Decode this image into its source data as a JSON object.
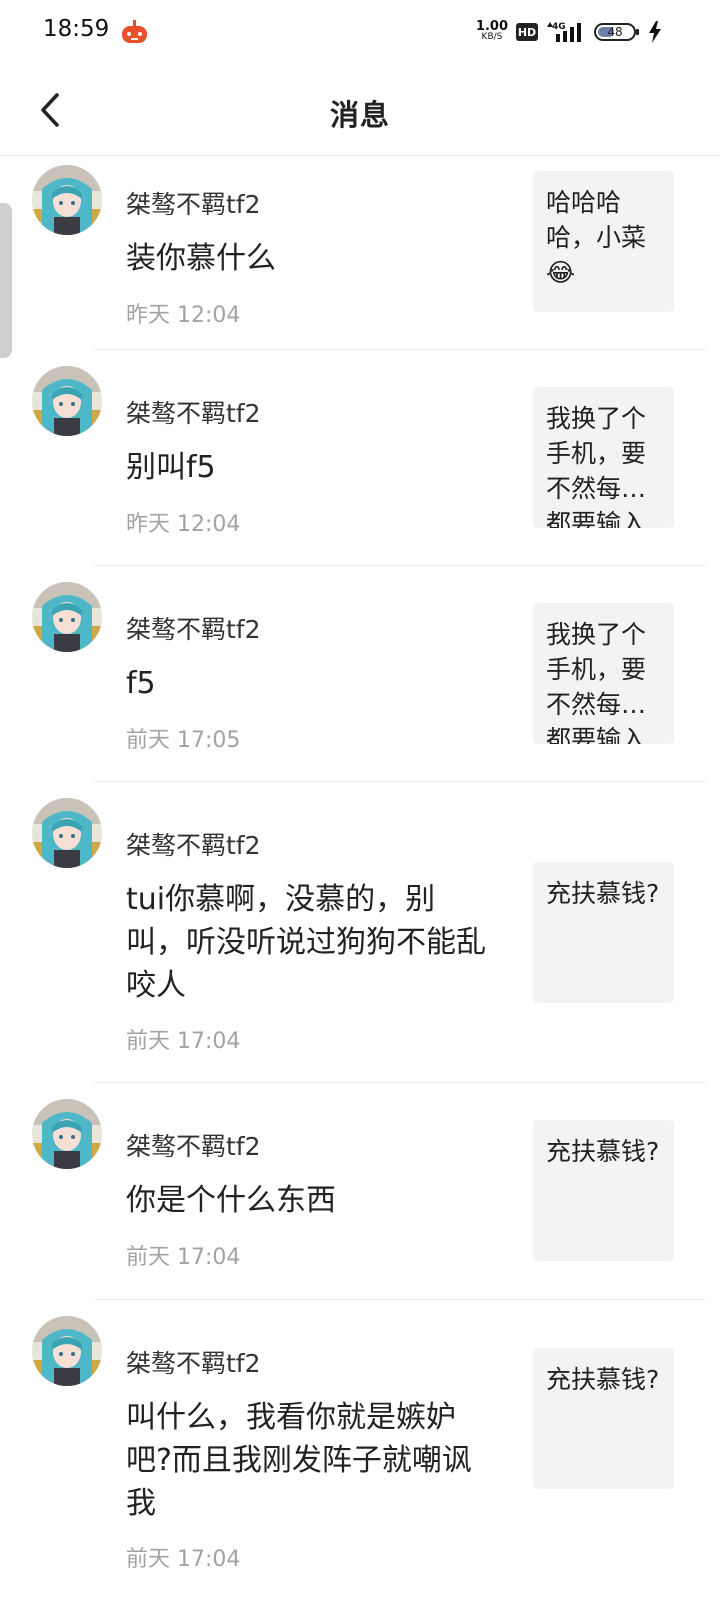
{
  "status_bar": {
    "time": "18:59",
    "net_speed_value": "1.00",
    "net_speed_unit": "KB/S",
    "hd_label": "HD",
    "network_label": "4G",
    "battery_level": "48"
  },
  "header": {
    "title": "消息",
    "back_icon": "chevron-left-icon"
  },
  "messages": [
    {
      "username": "桀骜不羁tf2",
      "comment": "装你慕什么",
      "time": "昨天 12:04",
      "quote": "哈哈哈哈，小菜😂"
    },
    {
      "username": "桀骜不羁tf2",
      "comment": "别叫f5",
      "time": "昨天 12:04",
      "quote": " 我换了个手机，要不然每次都要输入验证码"
    },
    {
      "username": "桀骜不羁tf2",
      "comment": "f5",
      "time": "前天 17:05",
      "quote": " 我换了个手机，要不然每次都要输入验证码"
    },
    {
      "username": "桀骜不羁tf2",
      "comment": "tui你慕啊，没慕的，别叫，听没听说过狗狗不能乱咬人",
      "time": "前天 17:04",
      "quote": "充扶慕钱?"
    },
    {
      "username": "桀骜不羁tf2",
      "comment": "你是个什么东西",
      "time": "前天 17:04",
      "quote": "充扶慕钱?"
    },
    {
      "username": "桀骜不羁tf2",
      "comment": "叫什么，我看你就是嫉妒吧?而且我刚发阵子就嘲讽我",
      "time": "前天 17:04",
      "quote": "充扶慕钱?"
    }
  ],
  "colors": {
    "avatar_hair": "#4fb8c8",
    "quote_bg": "#f3f3f3",
    "time_text": "#a3a3a3",
    "app_icon": "#e8502a"
  }
}
